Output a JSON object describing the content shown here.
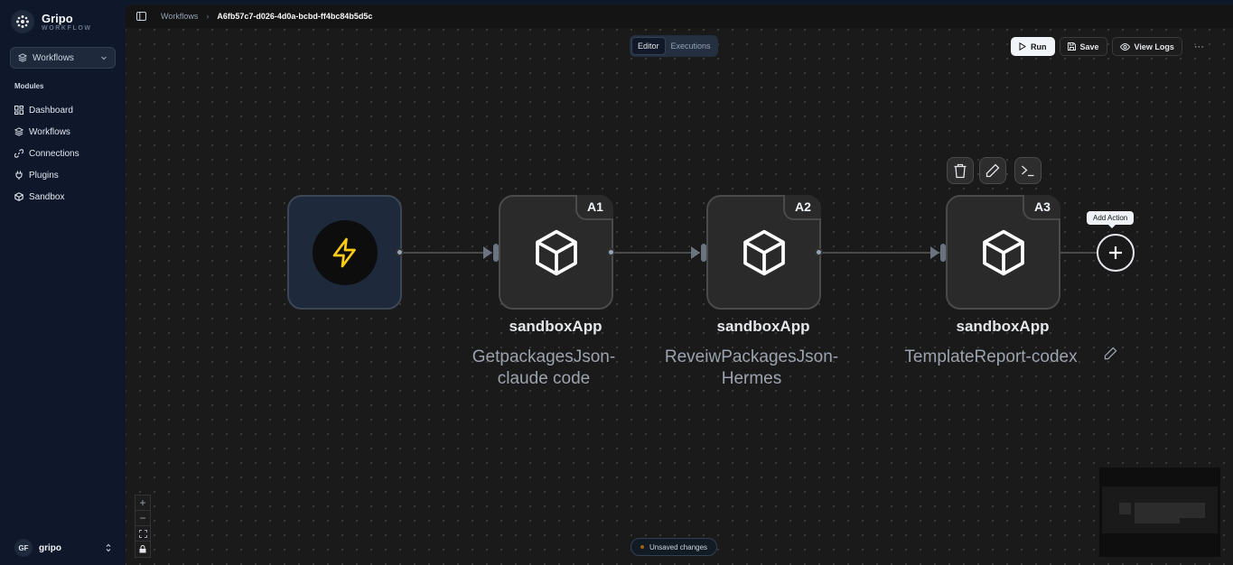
{
  "brand": {
    "name": "Gripo",
    "subtitle": "WORKFLOW"
  },
  "workspace_select": {
    "value": "Workflows"
  },
  "sidebar": {
    "section_label": "Modules",
    "items": [
      {
        "label": "Dashboard",
        "icon": "grid-icon"
      },
      {
        "label": "Workflows",
        "icon": "layers-icon"
      },
      {
        "label": "Connections",
        "icon": "link-icon"
      },
      {
        "label": "Plugins",
        "icon": "plug-icon"
      },
      {
        "label": "Sandbox",
        "icon": "cube-icon"
      }
    ]
  },
  "user": {
    "initials": "GF",
    "name": "gripo"
  },
  "breadcrumb": {
    "parent": "Workflows",
    "current": "A6fb57c7-d026-4d0a-bcbd-ff4bc84b5d5c"
  },
  "mode_tabs": {
    "editor": "Editor",
    "executions": "Executions"
  },
  "toolbar": {
    "run": "Run",
    "save": "Save",
    "view_logs": "View Logs",
    "more": "···"
  },
  "nodes": [
    {
      "badge": "A1",
      "title": "sandboxApp",
      "subtitle_line1": "GetpackagesJson-",
      "subtitle_line2": "claude code"
    },
    {
      "badge": "A2",
      "title": "sandboxApp",
      "subtitle_line1": "ReveiwPackagesJson-",
      "subtitle_line2": "Hermes"
    },
    {
      "badge": "A3",
      "title": "sandboxApp",
      "subtitle_line1": "TemplateReport-codex",
      "subtitle_line2": ""
    }
  ],
  "add_action_tooltip": "Add Action",
  "zoom_controls": {
    "zoom_in": "+",
    "zoom_out": "−"
  },
  "status": {
    "text": "Unsaved changes",
    "dot_color": "#a16207"
  },
  "colors": {
    "trigger_bolt": "#facc15",
    "run_button_bg": "#f1f5f9"
  }
}
